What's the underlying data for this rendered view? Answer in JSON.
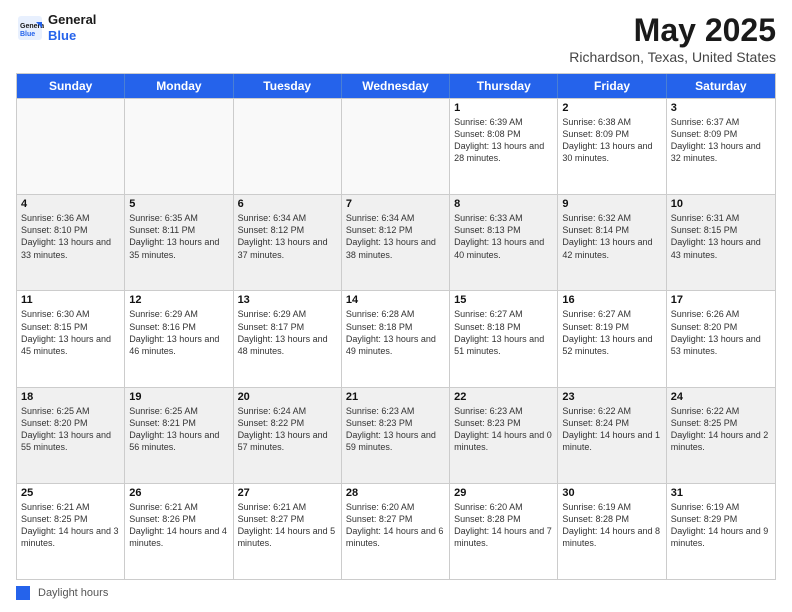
{
  "logo": {
    "line1": "General",
    "line2": "Blue"
  },
  "title": "May 2025",
  "location": "Richardson, Texas, United States",
  "days_of_week": [
    "Sunday",
    "Monday",
    "Tuesday",
    "Wednesday",
    "Thursday",
    "Friday",
    "Saturday"
  ],
  "weeks": [
    [
      {
        "day": "",
        "text": ""
      },
      {
        "day": "",
        "text": ""
      },
      {
        "day": "",
        "text": ""
      },
      {
        "day": "",
        "text": ""
      },
      {
        "day": "1",
        "text": "Sunrise: 6:39 AM\nSunset: 8:08 PM\nDaylight: 13 hours and 28 minutes."
      },
      {
        "day": "2",
        "text": "Sunrise: 6:38 AM\nSunset: 8:09 PM\nDaylight: 13 hours and 30 minutes."
      },
      {
        "day": "3",
        "text": "Sunrise: 6:37 AM\nSunset: 8:09 PM\nDaylight: 13 hours and 32 minutes."
      }
    ],
    [
      {
        "day": "4",
        "text": "Sunrise: 6:36 AM\nSunset: 8:10 PM\nDaylight: 13 hours and 33 minutes."
      },
      {
        "day": "5",
        "text": "Sunrise: 6:35 AM\nSunset: 8:11 PM\nDaylight: 13 hours and 35 minutes."
      },
      {
        "day": "6",
        "text": "Sunrise: 6:34 AM\nSunset: 8:12 PM\nDaylight: 13 hours and 37 minutes."
      },
      {
        "day": "7",
        "text": "Sunrise: 6:34 AM\nSunset: 8:12 PM\nDaylight: 13 hours and 38 minutes."
      },
      {
        "day": "8",
        "text": "Sunrise: 6:33 AM\nSunset: 8:13 PM\nDaylight: 13 hours and 40 minutes."
      },
      {
        "day": "9",
        "text": "Sunrise: 6:32 AM\nSunset: 8:14 PM\nDaylight: 13 hours and 42 minutes."
      },
      {
        "day": "10",
        "text": "Sunrise: 6:31 AM\nSunset: 8:15 PM\nDaylight: 13 hours and 43 minutes."
      }
    ],
    [
      {
        "day": "11",
        "text": "Sunrise: 6:30 AM\nSunset: 8:15 PM\nDaylight: 13 hours and 45 minutes."
      },
      {
        "day": "12",
        "text": "Sunrise: 6:29 AM\nSunset: 8:16 PM\nDaylight: 13 hours and 46 minutes."
      },
      {
        "day": "13",
        "text": "Sunrise: 6:29 AM\nSunset: 8:17 PM\nDaylight: 13 hours and 48 minutes."
      },
      {
        "day": "14",
        "text": "Sunrise: 6:28 AM\nSunset: 8:18 PM\nDaylight: 13 hours and 49 minutes."
      },
      {
        "day": "15",
        "text": "Sunrise: 6:27 AM\nSunset: 8:18 PM\nDaylight: 13 hours and 51 minutes."
      },
      {
        "day": "16",
        "text": "Sunrise: 6:27 AM\nSunset: 8:19 PM\nDaylight: 13 hours and 52 minutes."
      },
      {
        "day": "17",
        "text": "Sunrise: 6:26 AM\nSunset: 8:20 PM\nDaylight: 13 hours and 53 minutes."
      }
    ],
    [
      {
        "day": "18",
        "text": "Sunrise: 6:25 AM\nSunset: 8:20 PM\nDaylight: 13 hours and 55 minutes."
      },
      {
        "day": "19",
        "text": "Sunrise: 6:25 AM\nSunset: 8:21 PM\nDaylight: 13 hours and 56 minutes."
      },
      {
        "day": "20",
        "text": "Sunrise: 6:24 AM\nSunset: 8:22 PM\nDaylight: 13 hours and 57 minutes."
      },
      {
        "day": "21",
        "text": "Sunrise: 6:23 AM\nSunset: 8:23 PM\nDaylight: 13 hours and 59 minutes."
      },
      {
        "day": "22",
        "text": "Sunrise: 6:23 AM\nSunset: 8:23 PM\nDaylight: 14 hours and 0 minutes."
      },
      {
        "day": "23",
        "text": "Sunrise: 6:22 AM\nSunset: 8:24 PM\nDaylight: 14 hours and 1 minute."
      },
      {
        "day": "24",
        "text": "Sunrise: 6:22 AM\nSunset: 8:25 PM\nDaylight: 14 hours and 2 minutes."
      }
    ],
    [
      {
        "day": "25",
        "text": "Sunrise: 6:21 AM\nSunset: 8:25 PM\nDaylight: 14 hours and 3 minutes."
      },
      {
        "day": "26",
        "text": "Sunrise: 6:21 AM\nSunset: 8:26 PM\nDaylight: 14 hours and 4 minutes."
      },
      {
        "day": "27",
        "text": "Sunrise: 6:21 AM\nSunset: 8:27 PM\nDaylight: 14 hours and 5 minutes."
      },
      {
        "day": "28",
        "text": "Sunrise: 6:20 AM\nSunset: 8:27 PM\nDaylight: 14 hours and 6 minutes."
      },
      {
        "day": "29",
        "text": "Sunrise: 6:20 AM\nSunset: 8:28 PM\nDaylight: 14 hours and 7 minutes."
      },
      {
        "day": "30",
        "text": "Sunrise: 6:19 AM\nSunset: 8:28 PM\nDaylight: 14 hours and 8 minutes."
      },
      {
        "day": "31",
        "text": "Sunrise: 6:19 AM\nSunset: 8:29 PM\nDaylight: 14 hours and 9 minutes."
      }
    ]
  ],
  "footer": {
    "legend_label": "Daylight hours"
  }
}
